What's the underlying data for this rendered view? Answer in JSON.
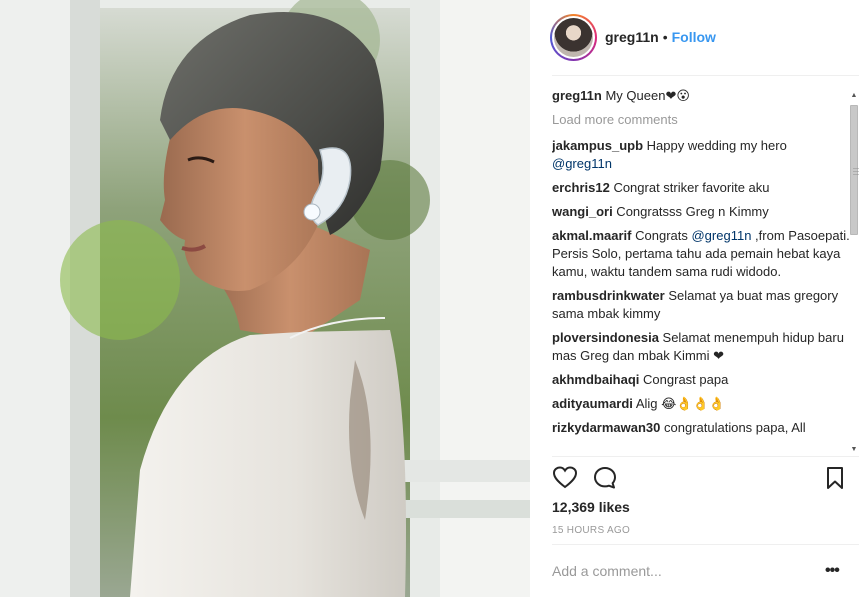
{
  "post": {
    "username": "greg11n",
    "follow_label": "Follow",
    "separator": "•",
    "likes": "12,369 likes",
    "timestamp": "15 HOURS AGO"
  },
  "caption": {
    "username": "greg11n",
    "text": " My Queen❤😮"
  },
  "load_more_label": "Load more comments",
  "comments": [
    {
      "user": "jakampus_upb",
      "text": " Happy wedding my hero ",
      "mention": "@greg11n",
      "rest": ""
    },
    {
      "user": "erchris12",
      "text": " Congrat striker favorite aku",
      "mention": "",
      "rest": ""
    },
    {
      "user": "wangi_ori",
      "text": " Congratsss Greg n Kimmy",
      "mention": "",
      "rest": ""
    },
    {
      "user": "akmal.maarif",
      "text": " Congrats ",
      "mention": "@greg11n",
      "rest": " ,from Pasoepati. Persis Solo, pertama tahu ada pemain hebat kaya kamu, waktu tandem sama rudi widodo."
    },
    {
      "user": "rambusdrinkwater",
      "text": " Selamat ya buat mas gregory sama mbak kimmy",
      "mention": "",
      "rest": ""
    },
    {
      "user": "ploversindonesia",
      "text": " Selamat menempuh hidup baru mas Greg dan mbak Kimmi ❤",
      "mention": "",
      "rest": ""
    },
    {
      "user": "akhmdbaihaqi",
      "text": " Congrast papa",
      "mention": "",
      "rest": ""
    },
    {
      "user": "adityaumardi",
      "text": " Alig 😂👌👌👌",
      "mention": "",
      "rest": ""
    },
    {
      "user": "rizkydarmawan30",
      "text": " congratulations papa, All",
      "mention": "",
      "rest": ""
    }
  ],
  "add_comment": {
    "placeholder": "Add a comment..."
  },
  "more_label": "•••",
  "icons": {
    "heart": "heart-outline-icon",
    "comment": "comment-bubble-icon",
    "bookmark": "bookmark-outline-icon"
  },
  "colors": {
    "follow": "#3897f0",
    "mention": "#003569",
    "muted": "#999999"
  }
}
